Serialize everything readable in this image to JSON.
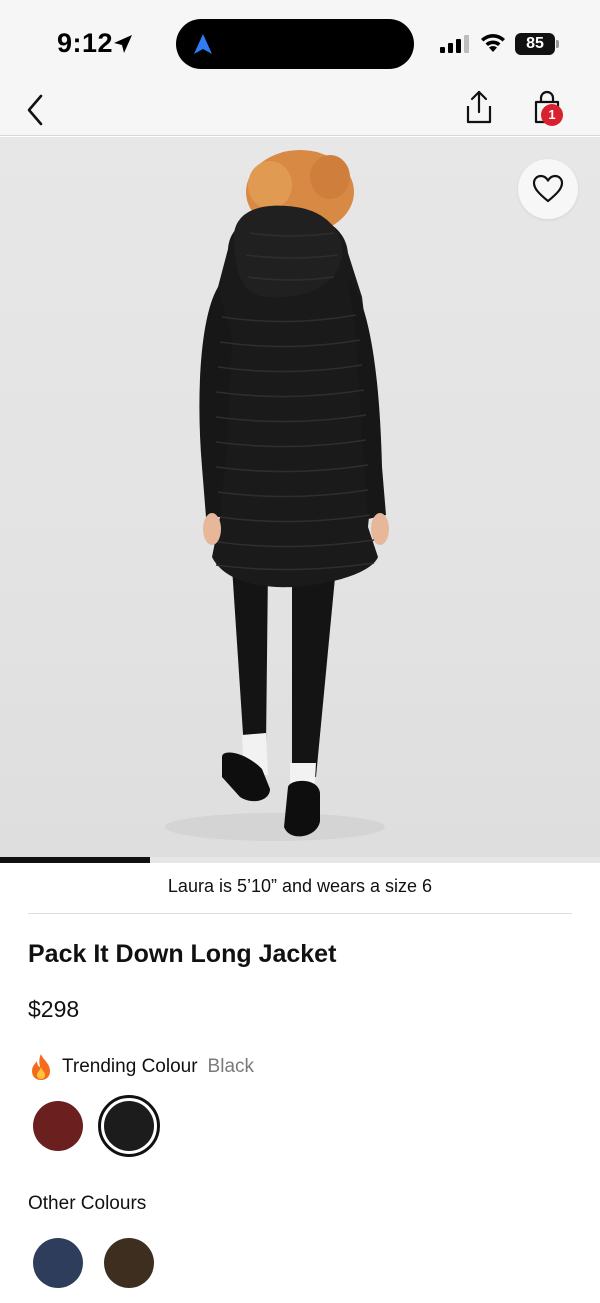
{
  "status_bar": {
    "time": "9:12",
    "battery": "85",
    "location_icon": "location-arrow-icon",
    "signal_icon": "cellular-signal-icon",
    "wifi_icon": "wifi-icon",
    "island_icon": "navigation-arrow-icon"
  },
  "nav": {
    "back_icon": "chevron-left-icon",
    "share_icon": "share-icon",
    "bag_icon": "shopping-bag-icon",
    "bag_count": "1"
  },
  "hero": {
    "favorite_icon": "heart-icon",
    "carousel_progress": 0.25,
    "model_caption": "Laura is 5’10” and wears a size 6"
  },
  "product": {
    "title": "Pack It Down Long Jacket",
    "price": "$298"
  },
  "trending": {
    "icon": "fire-icon",
    "label": "Trending Colour",
    "selected_colour": "Black",
    "swatches": [
      {
        "name": "burgundy",
        "color": "#6b1f1f",
        "selected": false
      },
      {
        "name": "black",
        "color": "#1c1c1c",
        "selected": true
      }
    ]
  },
  "other_colours": {
    "label": "Other Colours",
    "swatches": [
      {
        "name": "navy",
        "color": "#2e3d5c"
      },
      {
        "name": "brown",
        "color": "#3d2e20"
      }
    ]
  }
}
